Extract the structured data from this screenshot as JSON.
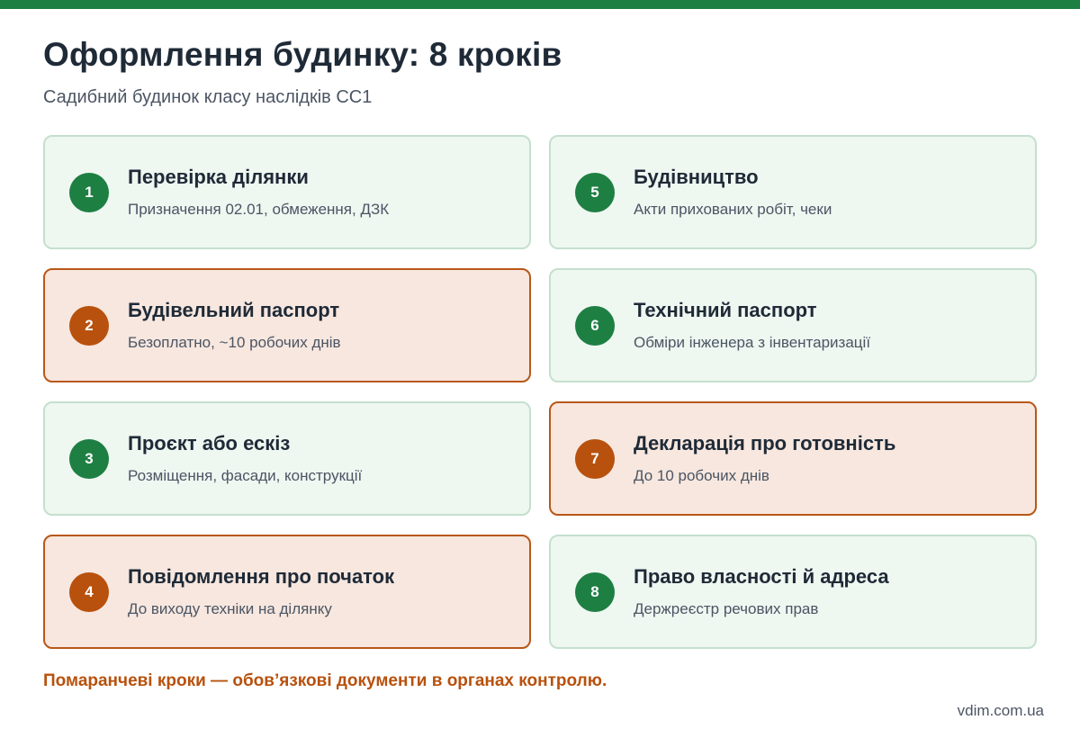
{
  "header": {
    "title": "Оформлення будинку: 8 кроків",
    "subtitle": "Садибний будинок класу наслідків СС1"
  },
  "colors": {
    "accent_green": "#1e7f43",
    "accent_orange": "#b8510d"
  },
  "steps": [
    {
      "number": "1",
      "title": "Перевірка ділянки",
      "desc": "Призначення 02.01, обмеження, ДЗК",
      "highlight": "green"
    },
    {
      "number": "2",
      "title": "Будівельний паспорт",
      "desc": "Безоплатно, ~10 робочих днів",
      "highlight": "orange"
    },
    {
      "number": "3",
      "title": "Проєкт або ескіз",
      "desc": "Розміщення, фасади, конструкції",
      "highlight": "green"
    },
    {
      "number": "4",
      "title": "Повідомлення про початок",
      "desc": "До виходу техніки на ділянку",
      "highlight": "orange"
    },
    {
      "number": "5",
      "title": "Будівництво",
      "desc": "Акти прихованих робіт, чеки",
      "highlight": "green"
    },
    {
      "number": "6",
      "title": "Технічний паспорт",
      "desc": "Обміри інженера з інвентаризації",
      "highlight": "green"
    },
    {
      "number": "7",
      "title": "Декларація про готовність",
      "desc": "До 10 робочих днів",
      "highlight": "orange"
    },
    {
      "number": "8",
      "title": "Право власності й адреса",
      "desc": "Держреєстр речових прав",
      "highlight": "green"
    }
  ],
  "note": "Помаранчеві кроки — обов’язкові документи в органах контролю.",
  "footer": {
    "link": "vdim.com.ua"
  }
}
